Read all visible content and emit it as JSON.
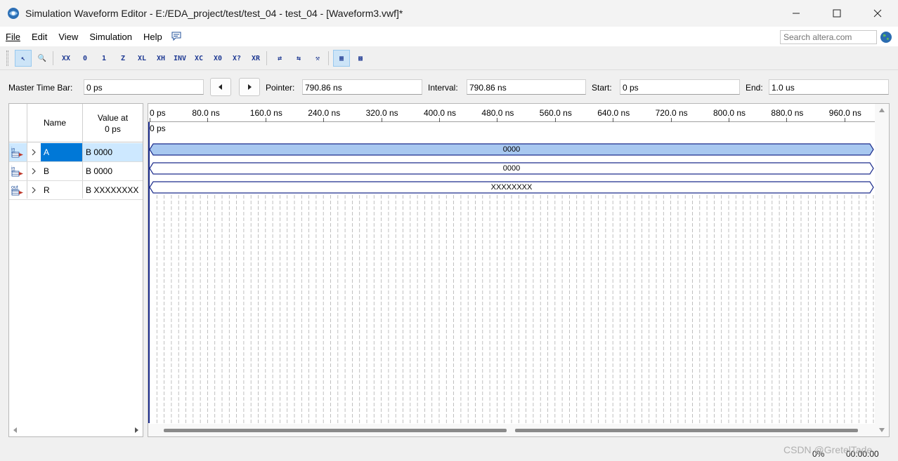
{
  "window": {
    "title": "Simulation Waveform Editor - E:/EDA_project/test/test_04 - test_04 - [Waveform3.vwf]*"
  },
  "menu": {
    "items": [
      {
        "label": "File",
        "name": "menu-file"
      },
      {
        "label": "Edit",
        "name": "menu-edit"
      },
      {
        "label": "View",
        "name": "menu-view"
      },
      {
        "label": "Simulation",
        "name": "menu-simulation"
      },
      {
        "label": "Help",
        "name": "menu-help"
      }
    ],
    "search_placeholder": "Search altera.com"
  },
  "toolbar": {
    "icons": [
      {
        "name": "selection-tool-icon",
        "glyph": "↖",
        "active": true
      },
      {
        "name": "zoom-tool-icon",
        "glyph": "🔍",
        "active": false
      },
      {
        "name": "force-unknown-icon",
        "glyph": "XX",
        "active": false
      },
      {
        "name": "force-low-icon",
        "glyph": "0",
        "active": false
      },
      {
        "name": "force-high-icon",
        "glyph": "1",
        "active": false
      },
      {
        "name": "force-high-impedance-icon",
        "glyph": "Z",
        "active": false
      },
      {
        "name": "force-weak-low-icon",
        "glyph": "XL",
        "active": false
      },
      {
        "name": "force-weak-high-icon",
        "glyph": "XH",
        "active": false
      },
      {
        "name": "invert-icon",
        "glyph": "INV",
        "active": false
      },
      {
        "name": "count-value-icon",
        "glyph": "XC",
        "active": false
      },
      {
        "name": "overwrite-clock-icon",
        "glyph": "X0",
        "active": false
      },
      {
        "name": "random-values-icon",
        "glyph": "X?",
        "active": false
      },
      {
        "name": "arbitrary-value-icon",
        "glyph": "XR",
        "active": false
      },
      {
        "name": "run-functional-simulation-icon",
        "glyph": "⇄",
        "active": false
      },
      {
        "name": "run-timing-simulation-icon",
        "glyph": "⇆",
        "active": false
      },
      {
        "name": "generate-netlist-icon",
        "glyph": "⚒",
        "active": false
      },
      {
        "name": "snap-to-grid-icon",
        "glyph": "▦",
        "active": true
      },
      {
        "name": "sort-icon",
        "glyph": "▩",
        "active": false
      }
    ]
  },
  "timebar": {
    "master_label": "Master Time Bar:",
    "master_value": "0 ps",
    "pointer_label": "Pointer:",
    "pointer_value": "790.86 ns",
    "interval_label": "Interval:",
    "interval_value": "790.86 ns",
    "start_label": "Start:",
    "start_value": "0 ps",
    "end_label": "End:",
    "end_value": "1.0 us"
  },
  "signal_panel": {
    "header_name": "Name",
    "header_value_line1": "Value at",
    "header_value_line2": "0 ps",
    "signals": [
      {
        "direction": "in",
        "name": "A",
        "value": "B 0000",
        "selected": true
      },
      {
        "direction": "in",
        "name": "B",
        "value": "B 0000",
        "selected": false
      },
      {
        "direction": "out",
        "name": "R",
        "value": "B XXXXXXXX",
        "selected": false
      }
    ]
  },
  "waveform": {
    "ruler_labels": [
      "0 ps",
      "80.0 ns",
      "160.0 ns",
      "240.0 ns",
      "320.0 ns",
      "400.0 ns",
      "480.0 ns",
      "560.0 ns",
      "640.0 ns",
      "720.0 ns",
      "800.0 ns",
      "880.0 ns",
      "960.0 ns"
    ],
    "cursor_label": "0 ps",
    "bus_values": [
      "0000",
      "0000",
      "XXXXXXXX"
    ],
    "colors": {
      "bus_line": "#1c2c8c",
      "selected_fill": "#a8c8f0",
      "cursor": "#1c2c8c",
      "grid": "#b0b0b0"
    }
  },
  "status": {
    "progress": "0%",
    "elapsed": "00:00:00"
  },
  "watermark": "CSDN @GretelTade"
}
